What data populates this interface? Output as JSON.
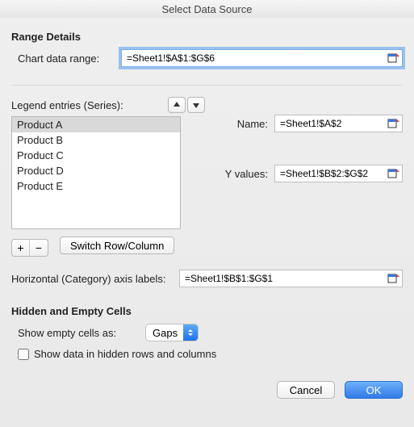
{
  "window": {
    "title": "Select Data Source"
  },
  "range_details": {
    "heading": "Range Details",
    "chart_range_label": "Chart data range:",
    "chart_range_value": "=Sheet1!$A$1:$G$6"
  },
  "series": {
    "legend_label": "Legend entries (Series):",
    "items": [
      {
        "label": "Product A",
        "selected": true
      },
      {
        "label": "Product B",
        "selected": false
      },
      {
        "label": "Product C",
        "selected": false
      },
      {
        "label": "Product D",
        "selected": false
      },
      {
        "label": "Product E",
        "selected": false
      }
    ],
    "switch_label": "Switch Row/Column",
    "name_label": "Name:",
    "name_value": "=Sheet1!$A$2",
    "yvalues_label": "Y values:",
    "yvalues_value": "=Sheet1!$B$2:$G$2"
  },
  "category": {
    "label": "Horizontal (Category) axis labels:",
    "value": "=Sheet1!$B$1:$G$1"
  },
  "hidden_empty": {
    "heading": "Hidden and Empty Cells",
    "show_empty_label": "Show empty cells as:",
    "show_empty_value": "Gaps",
    "show_hidden_label": "Show data in hidden rows and columns",
    "show_hidden_checked": false
  },
  "footer": {
    "cancel": "Cancel",
    "ok": "OK"
  }
}
